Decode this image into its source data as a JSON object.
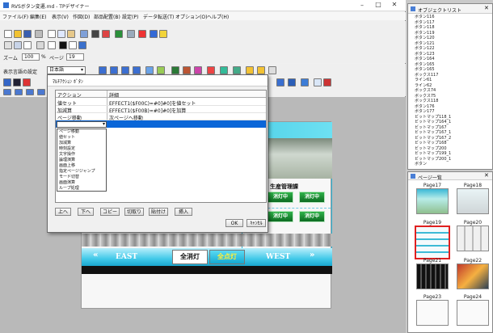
{
  "app": {
    "title": "RVSボタン変遷.md - TPデザイナー"
  },
  "menu": [
    "ファイル(F)",
    "編集(E)",
    "表示(V)",
    "作図(D)",
    "部品配置(B)",
    "設定(P)",
    "データ転送(T)",
    "オプション(O)",
    "ヘルプ(H)"
  ],
  "zoom": {
    "label": "ズーム",
    "value": "100",
    "unit": "%",
    "page_label": "ページ",
    "page_value": "19"
  },
  "lang": {
    "label": "表示言語の設定",
    "value": "日本語"
  },
  "dialog": {
    "title": "ﾏﾙﾁｱｸｼｮﾝ ﾎﾞﾀﾝ",
    "headers": [
      "アクション",
      "詳細"
    ],
    "rows": [
      {
        "action": "値セット",
        "detail": "EFFECT1($F00C)=#0]#0]を値セット"
      },
      {
        "action": "加減算",
        "detail": "EFFECT1($F00B)=#0]#0]を加算"
      },
      {
        "action": "ページ移動",
        "detail": "次ページへ移動"
      }
    ],
    "dropdown_options": [
      "ページ移動",
      "値セット",
      "加減算",
      "時刻設定",
      "文字操作",
      "論理演算",
      "画面上移",
      "指定ページジャンプ",
      "モード切替",
      "画面演算",
      "ループ処理"
    ],
    "buttons": {
      "up": "上へ",
      "down": "下へ",
      "copy": "コピー",
      "cut": "切取り",
      "paste": "貼付け",
      "insert": "挿入",
      "ok": "OK",
      "cancel": "ｷｬﾝｾﾙ"
    }
  },
  "canvas": {
    "heading": "生産管理課",
    "lamp_label": "消灯中",
    "east": "EAST",
    "west": "WEST",
    "all_off": "全消灯",
    "all_on": "全点灯"
  },
  "objects": {
    "title": "オブジェクトリスト",
    "items": [
      "ボタン116",
      "ボタン117",
      "ボタン118",
      "ボタン119",
      "ボタン120",
      "ボタン121",
      "ボタン122",
      "ボタン123",
      "ボタン164",
      "ボタン165",
      "ボタン165",
      "ボックス117",
      "ライン61",
      "ライン62",
      "ボックス74",
      "ボックス75",
      "ボックス118",
      "ボタン176",
      "ボタン177",
      "ビットマップ118_1",
      "ビットマップ164_1",
      "ビットマップ167",
      "ビットマップ167_1",
      "ビットマップ167_2",
      "ビットマップ168",
      "ビットマップ200",
      "ビットマップ199_1",
      "ビットマップ200_1",
      "ボタン"
    ]
  },
  "pages": {
    "title": "ページ一覧",
    "items": [
      "Page17",
      "Page18",
      "Page19",
      "Page20",
      "Page21",
      "Page22",
      "Page23",
      "Page24"
    ],
    "selected": "Page19"
  },
  "colors": {
    "accent": "#e02020",
    "lamp_green": "#2fae45",
    "banner_cyan": "#35c7e6",
    "dialog_select": "#0a66d8"
  }
}
